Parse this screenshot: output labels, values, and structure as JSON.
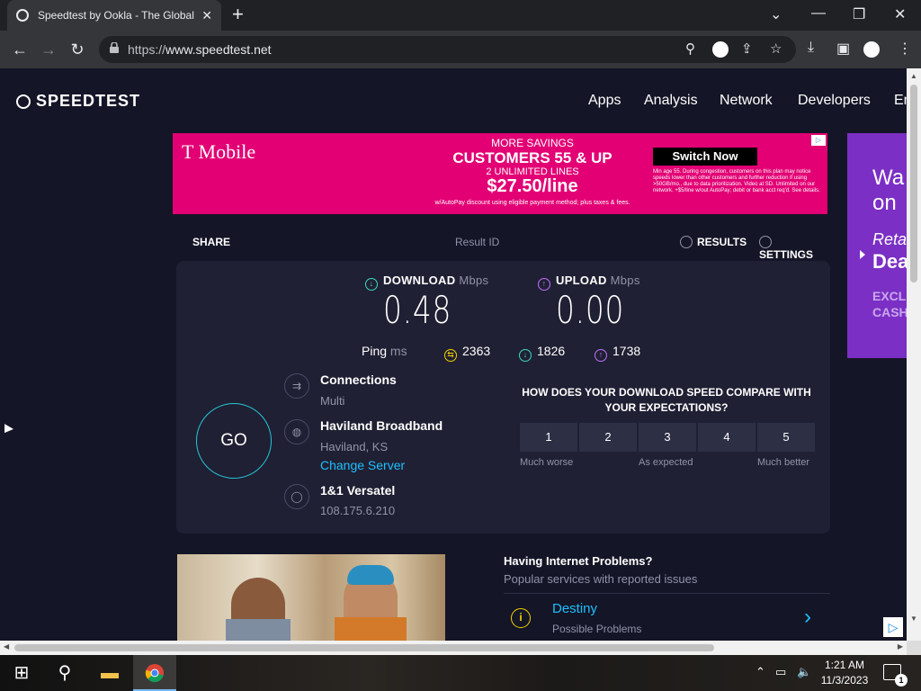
{
  "browser": {
    "tab_title": "Speedtest by Ookla - The Global",
    "tab_close": "✕",
    "new_tab": "+",
    "url_prefix": "https://",
    "url_host": "www.speedtest.net"
  },
  "site": {
    "logo": "SPEEDTEST",
    "nav": [
      "Apps",
      "Analysis",
      "Network",
      "Developers",
      "En"
    ]
  },
  "ad": {
    "brand": "T Mobile",
    "line1": "MORE SAVINGS",
    "line2": "CUSTOMERS 55 & UP",
    "line3": "2 UNLIMITED LINES",
    "price": "$27.50/line",
    "line5": "w/AutoPay discount using eligible payment method; plus taxes & fees.",
    "cta": "Switch Now",
    "fine": "Min age 55. During congestion, customers on this plan may notice speeds lower than other customers and further reduction if using >50GB/mo., due to data prioritization. Video at SD. Unlimited on our network. +$5/line w/out AutoPay; debit or bank acct req'd. See details."
  },
  "side_ad": {
    "line1": "Wa",
    "line2": "on",
    "line3": "Reta",
    "line4": "Dea",
    "line5": "EXCL",
    "line6": "CASH"
  },
  "result_bar": {
    "share": "SHARE",
    "result_id": "Result ID",
    "results": "RESULTS",
    "settings": "SETTINGS"
  },
  "test": {
    "download_label": "DOWNLOAD",
    "upload_label": "UPLOAD",
    "unit": "Mbps",
    "download_value": "0.48",
    "upload_value": "0.00",
    "ping_label": "Ping",
    "ping_unit": "ms",
    "ping_idle": "2363",
    "ping_down": "1826",
    "ping_up": "1738",
    "go": "GO"
  },
  "server": {
    "connections_label": "Connections",
    "connections_value": "Multi",
    "isp": "Haviland Broadband",
    "location": "Haviland, KS",
    "change_server": "Change Server",
    "host": "1&1 Versatel",
    "ip": "108.175.6.210"
  },
  "survey": {
    "question": "HOW DOES YOUR DOWNLOAD SPEED COMPARE WITH YOUR EXPECTATIONS?",
    "options": [
      "1",
      "2",
      "3",
      "4",
      "5"
    ],
    "low": "Much worse",
    "mid": "As expected",
    "high": "Much better"
  },
  "problems": {
    "heading": "Having Internet Problems?",
    "sub": "Popular services with reported issues",
    "service": "Destiny",
    "status": "Possible Problems"
  },
  "taskbar": {
    "time": "1:21 AM",
    "date": "11/3/2023",
    "notif_count": "1"
  },
  "colors": {
    "accent_cyan": "#1cbfff",
    "go_ring": "#26c6da",
    "download_icon": "#3dd9c1",
    "upload_icon": "#bf71ff",
    "ad_magenta": "#e20074"
  }
}
